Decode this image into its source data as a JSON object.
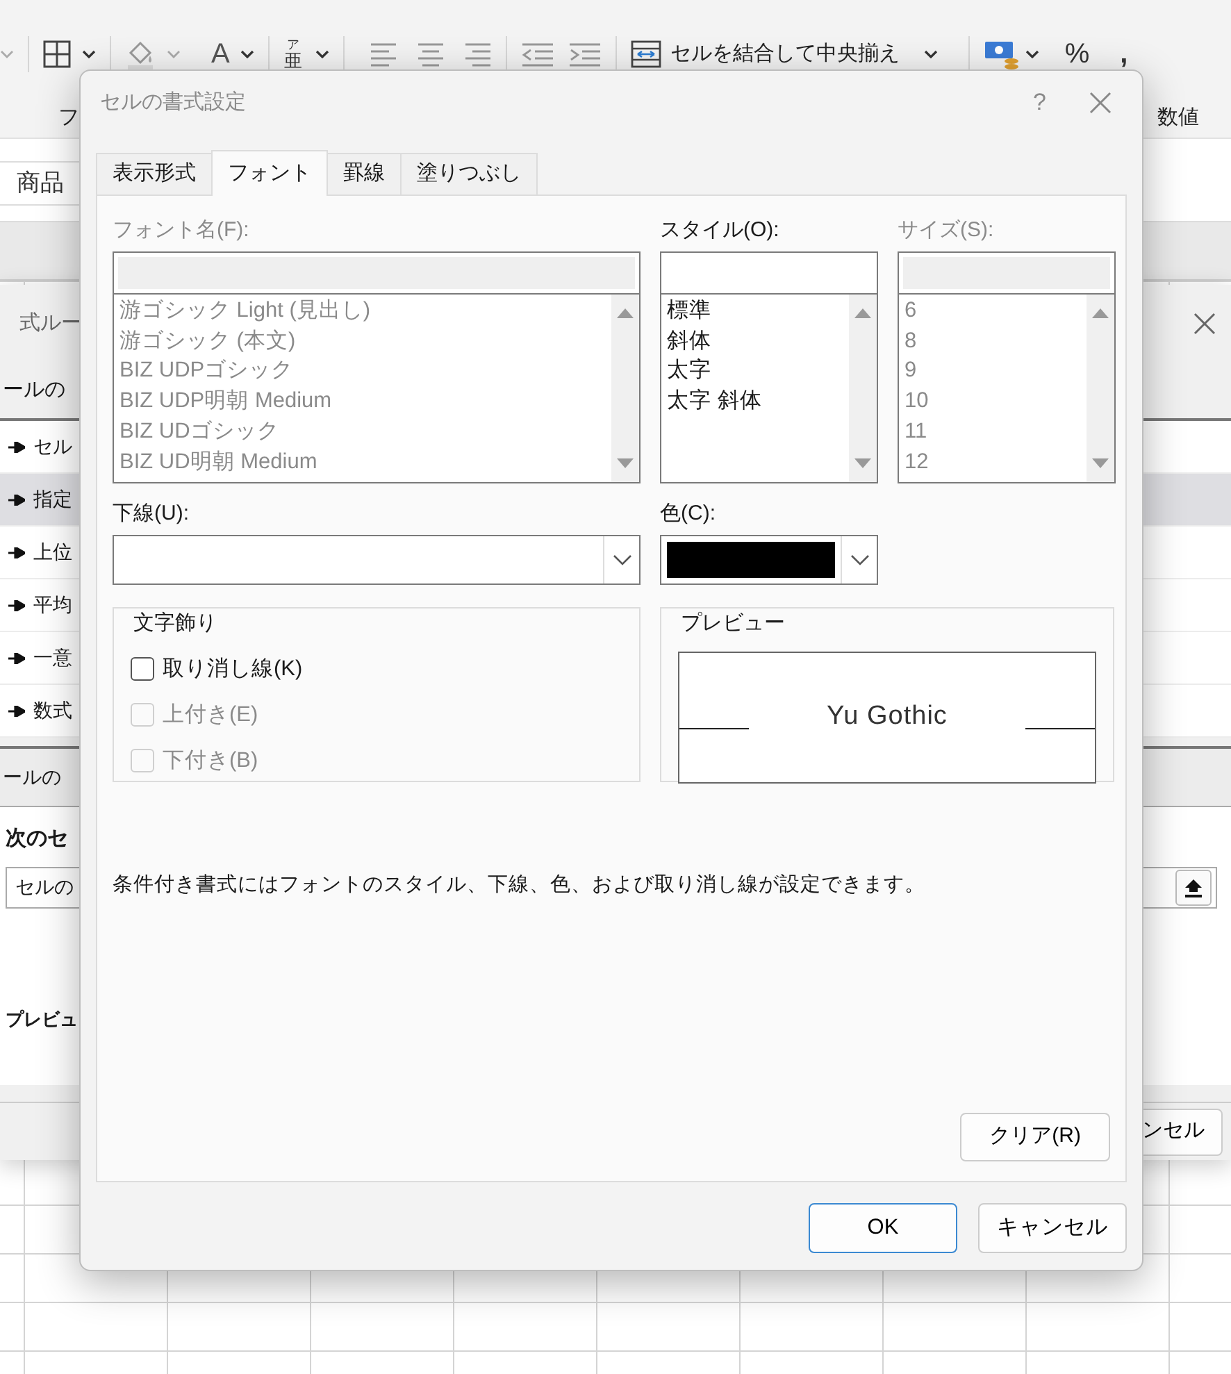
{
  "background": {
    "ribbon": {
      "font_color_glyph": "A",
      "phonetic_glyphs": [
        "ア",
        "亜"
      ],
      "merge_button": "セルを結合して中央揃え",
      "percent_glyph": "%",
      "comma_glyph": ",",
      "group_labels": [
        "フ",
        "数値"
      ]
    },
    "sheet_tab": "商品",
    "rule_dialog": {
      "title": "式ルー",
      "section_label": "ールの",
      "rule_types": [
        {
          "label": "セル",
          "selected": false
        },
        {
          "label": "指定",
          "selected": true
        },
        {
          "label": "上位",
          "selected": false
        },
        {
          "label": "平均",
          "selected": false
        },
        {
          "label": "一意",
          "selected": false
        },
        {
          "label": "数式",
          "selected": false
        }
      ],
      "description_label": "ールの",
      "condition_label": "次のセ",
      "condition_value": "セルの",
      "preview_label": "プレビュ",
      "cancel_button": "ンセル"
    }
  },
  "dialog": {
    "title": "セルの書式設定",
    "help": "?",
    "tabs": [
      {
        "label": "表示形式",
        "selected": false
      },
      {
        "label": "フォント",
        "selected": true
      },
      {
        "label": "罫線",
        "selected": false
      },
      {
        "label": "塗りつぶし",
        "selected": false
      }
    ],
    "lists": [
      {
        "label": "フォント名(F):",
        "disabled": true,
        "items": [
          "游ゴシック Light (見出し)",
          "游ゴシック (本文)",
          "BIZ UDPゴシック",
          "BIZ UDP明朝 Medium",
          "BIZ UDゴシック",
          "BIZ UD明朝 Medium"
        ]
      },
      {
        "label": "スタイル(O):",
        "disabled": false,
        "items": [
          "標準",
          "斜体",
          "太字",
          "太字 斜体"
        ]
      },
      {
        "label": "サイズ(S):",
        "disabled": true,
        "items": [
          "6",
          "8",
          "9",
          "10",
          "11",
          "12"
        ]
      }
    ],
    "underline": {
      "label": "下線(U):"
    },
    "color": {
      "label": "色(C):"
    },
    "effects": {
      "title": "文字飾り",
      "options": [
        {
          "label": "取り消し線(K)",
          "checked": false,
          "disabled": false
        },
        {
          "label": "上付き(E)",
          "checked": false,
          "disabled": true
        },
        {
          "label": "下付き(B)",
          "checked": false,
          "disabled": true
        }
      ]
    },
    "preview": {
      "title": "プレビュー",
      "sample": "Yu Gothic"
    },
    "note": "条件付き書式にはフォントのスタイル、下線、色、および取り消し線が設定できます。",
    "clear_button": "クリア(R)",
    "buttons": [
      {
        "label": "OK",
        "default": true
      },
      {
        "label": "キャンセル",
        "default": false
      }
    ]
  }
}
